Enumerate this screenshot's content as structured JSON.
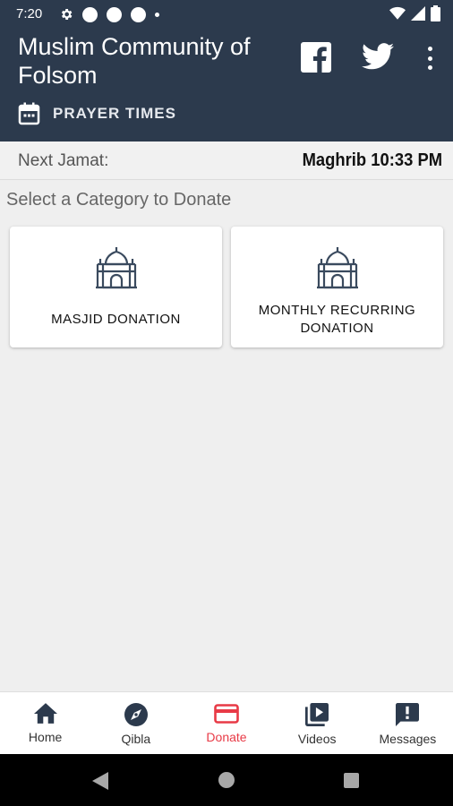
{
  "status_bar": {
    "time": "7:20",
    "icons": [
      "settings-icon",
      "notification-dot-icon",
      "notification-dot-icon",
      "notification-dot-icon",
      "small-dot-icon",
      "wifi-icon",
      "signal-icon",
      "battery-icon"
    ]
  },
  "header": {
    "title": "Muslim Community of Folsom",
    "prayer_times_label": "PRAYER TIMES",
    "icons": [
      "calendar-icon",
      "facebook-icon",
      "twitter-icon",
      "more-vert-icon"
    ],
    "background_color": "#2c3a4d"
  },
  "jamat": {
    "label": "Next Jamat:",
    "value": "Maghrib 10:33 PM"
  },
  "donate": {
    "section_title": "Select a Category to Donate",
    "categories": [
      {
        "label": "MASJID DONATION",
        "icon": "mosque-icon"
      },
      {
        "label": "MONTHLY RECURRING DONATION",
        "icon": "mosque-icon"
      }
    ]
  },
  "bottom_nav": {
    "items": [
      {
        "label": "Home",
        "icon": "home-icon"
      },
      {
        "label": "Qibla",
        "icon": "compass-icon"
      },
      {
        "label": "Donate",
        "icon": "credit-card-icon",
        "active": true
      },
      {
        "label": "Videos",
        "icon": "video-library-icon"
      },
      {
        "label": "Messages",
        "icon": "message-alert-icon"
      }
    ],
    "active_color": "#e83a46"
  },
  "system_nav": {
    "icons": [
      "back-icon",
      "home-circle-icon",
      "recents-icon"
    ]
  }
}
